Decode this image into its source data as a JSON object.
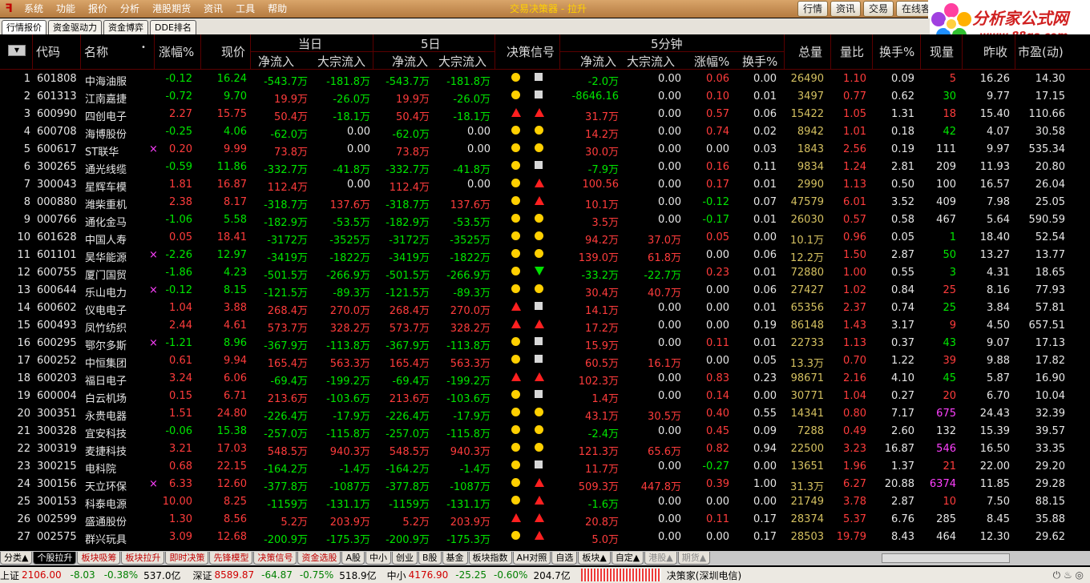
{
  "menu": {
    "items": [
      "系统",
      "功能",
      "报价",
      "分析",
      "港股期货",
      "资讯",
      "工具",
      "帮助"
    ],
    "title": "交易决策器 - 拉升",
    "tabs": [
      "行情",
      "资讯",
      "交易",
      "在线客"
    ]
  },
  "brand": {
    "name": "分析家公式网",
    "url": "www.88gs.com"
  },
  "subtabs": [
    "行情报价",
    "资金驱动力",
    "资金博弈",
    "DDE排名"
  ],
  "headers": {
    "code": "代码",
    "name": "名称",
    "change_pct": "涨幅%",
    "price": "现价",
    "day": "当日",
    "day5": "5日",
    "net_in": "净流入",
    "block_in": "大宗流入",
    "signal": "决策信号",
    "min5": "5分钟",
    "chg": "涨幅%",
    "turnover": "换手%",
    "vol": "总量",
    "vol_ratio": "量比",
    "turn": "换手%",
    "cur_vol": "现量",
    "prev_close": "昨收",
    "pe": "市盈(动)"
  },
  "rows": [
    {
      "n": "1",
      "code": "601808",
      "name": "中海油服",
      "m": "",
      "chg": "-0.12",
      "price": "16.24",
      "dn": "-543.7万",
      "db": "-181.8万",
      "fn": "-543.7万",
      "fb": "-181.8万",
      "s1": "c",
      "s2": "q",
      "mn": "-2.0万",
      "mb": "0.00",
      "mc": "0.06",
      "mt": "0.00",
      "vol": "26490",
      "vr": "1.10",
      "to": "0.09",
      "cv": "5",
      "pc": "16.26",
      "pe": "14.30"
    },
    {
      "n": "2",
      "code": "601313",
      "name": "江南嘉捷",
      "m": "",
      "chg": "-0.72",
      "price": "9.70",
      "dn": "19.9万",
      "db": "-26.0万",
      "fn": "19.9万",
      "fb": "-26.0万",
      "s1": "c",
      "s2": "q",
      "mn": "-8646.16",
      "mb": "0.00",
      "mc": "0.10",
      "mt": "0.01",
      "vol": "3497",
      "vr": "0.77",
      "to": "0.62",
      "cv": "30",
      "pc": "9.77",
      "pe": "17.15"
    },
    {
      "n": "3",
      "code": "600990",
      "name": "四创电子",
      "m": "",
      "chg": "2.27",
      "price": "15.75",
      "dn": "50.4万",
      "db": "-18.1万",
      "fn": "50.4万",
      "fb": "-18.1万",
      "s1": "u",
      "s2": "u",
      "mn": "31.7万",
      "mb": "0.00",
      "mc": "0.57",
      "mt": "0.06",
      "vol": "15422",
      "vr": "1.05",
      "to": "1.31",
      "cv": "18",
      "pc": "15.40",
      "pe": "110.66"
    },
    {
      "n": "4",
      "code": "600708",
      "name": "海博股份",
      "m": "",
      "chg": "-0.25",
      "price": "4.06",
      "dn": "-62.0万",
      "db": "0.00",
      "fn": "-62.0万",
      "fb": "0.00",
      "s1": "c",
      "s2": "c",
      "mn": "14.2万",
      "mb": "0.00",
      "mc": "0.74",
      "mt": "0.02",
      "vol": "8942",
      "vr": "1.01",
      "to": "0.18",
      "cv": "42",
      "pc": "4.07",
      "pe": "30.58"
    },
    {
      "n": "5",
      "code": "600617",
      "name": "ST联华",
      "m": "×",
      "chg": "0.20",
      "price": "9.99",
      "dn": "73.8万",
      "db": "0.00",
      "fn": "73.8万",
      "fb": "0.00",
      "s1": "c",
      "s2": "c",
      "mn": "30.0万",
      "mb": "0.00",
      "mc": "0.00",
      "mt": "0.03",
      "vol": "1843",
      "vr": "2.56",
      "to": "0.19",
      "cv": "111",
      "pc": "9.97",
      "pe": "535.34"
    },
    {
      "n": "6",
      "code": "300265",
      "name": "通光线缆",
      "m": "",
      "chg": "-0.59",
      "price": "11.86",
      "dn": "-332.7万",
      "db": "-41.8万",
      "fn": "-332.7万",
      "fb": "-41.8万",
      "s1": "c",
      "s2": "q",
      "mn": "-7.9万",
      "mb": "0.00",
      "mc": "0.16",
      "mt": "0.11",
      "vol": "9834",
      "vr": "1.24",
      "to": "2.81",
      "cv": "209",
      "pc": "11.93",
      "pe": "20.80"
    },
    {
      "n": "7",
      "code": "300043",
      "name": "星辉车模",
      "m": "",
      "chg": "1.81",
      "price": "16.87",
      "dn": "112.4万",
      "db": "0.00",
      "fn": "112.4万",
      "fb": "0.00",
      "s1": "c",
      "s2": "u",
      "mn": "100.56",
      "mb": "0.00",
      "mc": "0.17",
      "mt": "0.01",
      "vol": "2990",
      "vr": "1.13",
      "to": "0.50",
      "cv": "100",
      "pc": "16.57",
      "pe": "26.04"
    },
    {
      "n": "8",
      "code": "000880",
      "name": "潍柴重机",
      "m": "",
      "chg": "2.38",
      "price": "8.17",
      "dn": "-318.7万",
      "db": "137.6万",
      "fn": "-318.7万",
      "fb": "137.6万",
      "s1": "c",
      "s2": "u",
      "mn": "10.1万",
      "mb": "0.00",
      "mc": "-0.12",
      "mt": "0.07",
      "vol": "47579",
      "vr": "6.01",
      "to": "3.52",
      "cv": "409",
      "pc": "7.98",
      "pe": "25.05"
    },
    {
      "n": "9",
      "code": "000766",
      "name": "通化金马",
      "m": "",
      "chg": "-1.06",
      "price": "5.58",
      "dn": "-182.9万",
      "db": "-53.5万",
      "fn": "-182.9万",
      "fb": "-53.5万",
      "s1": "c",
      "s2": "c",
      "mn": "3.5万",
      "mb": "0.00",
      "mc": "-0.17",
      "mt": "0.01",
      "vol": "26030",
      "vr": "0.57",
      "to": "0.58",
      "cv": "467",
      "pc": "5.64",
      "pe": "590.59"
    },
    {
      "n": "10",
      "code": "601628",
      "name": "中国人寿",
      "m": "",
      "chg": "0.05",
      "price": "18.41",
      "dn": "-3172万",
      "db": "-3525万",
      "fn": "-3172万",
      "fb": "-3525万",
      "s1": "c",
      "s2": "c",
      "mn": "94.2万",
      "mb": "37.0万",
      "mc": "0.05",
      "mt": "0.00",
      "vol": "10.1万",
      "vr": "0.96",
      "to": "0.05",
      "cv": "1",
      "pc": "18.40",
      "pe": "52.54"
    },
    {
      "n": "11",
      "code": "601101",
      "name": "昊华能源",
      "m": "×",
      "chg": "-2.26",
      "price": "12.97",
      "dn": "-3419万",
      "db": "-1822万",
      "fn": "-3419万",
      "fb": "-1822万",
      "s1": "c",
      "s2": "c",
      "mn": "139.0万",
      "mb": "61.8万",
      "mc": "0.00",
      "mt": "0.06",
      "vol": "12.2万",
      "vr": "1.50",
      "to": "2.87",
      "cv": "50",
      "pc": "13.27",
      "pe": "13.77"
    },
    {
      "n": "12",
      "code": "600755",
      "name": "厦门国贸",
      "m": "",
      "chg": "-1.86",
      "price": "4.23",
      "dn": "-501.5万",
      "db": "-266.9万",
      "fn": "-501.5万",
      "fb": "-266.9万",
      "s1": "c",
      "s2": "d",
      "mn": "-33.2万",
      "mb": "-22.7万",
      "mc": "0.23",
      "mt": "0.01",
      "vol": "72880",
      "vr": "1.00",
      "to": "0.55",
      "cv": "3",
      "pc": "4.31",
      "pe": "18.65"
    },
    {
      "n": "13",
      "code": "600644",
      "name": "乐山电力",
      "m": "×",
      "chg": "-0.12",
      "price": "8.15",
      "dn": "-121.5万",
      "db": "-89.3万",
      "fn": "-121.5万",
      "fb": "-89.3万",
      "s1": "c",
      "s2": "c",
      "mn": "30.4万",
      "mb": "40.7万",
      "mc": "0.00",
      "mt": "0.06",
      "vol": "27427",
      "vr": "1.02",
      "to": "0.84",
      "cv": "25",
      "pc": "8.16",
      "pe": "77.93"
    },
    {
      "n": "14",
      "code": "600602",
      "name": "仪电电子",
      "m": "",
      "chg": "1.04",
      "price": "3.88",
      "dn": "268.4万",
      "db": "270.0万",
      "fn": "268.4万",
      "fb": "270.0万",
      "s1": "u",
      "s2": "q",
      "mn": "14.1万",
      "mb": "0.00",
      "mc": "0.00",
      "mt": "0.01",
      "vol": "65356",
      "vr": "2.37",
      "to": "0.74",
      "cv": "25",
      "pc": "3.84",
      "pe": "57.81"
    },
    {
      "n": "15",
      "code": "600493",
      "name": "凤竹纺织",
      "m": "",
      "chg": "2.44",
      "price": "4.61",
      "dn": "573.7万",
      "db": "328.2万",
      "fn": "573.7万",
      "fb": "328.2万",
      "s1": "u",
      "s2": "u",
      "mn": "17.2万",
      "mb": "0.00",
      "mc": "0.00",
      "mt": "0.19",
      "vol": "86148",
      "vr": "1.43",
      "to": "3.17",
      "cv": "9",
      "pc": "4.50",
      "pe": "657.51"
    },
    {
      "n": "16",
      "code": "600295",
      "name": "鄂尔多斯",
      "m": "×",
      "chg": "-1.21",
      "price": "8.96",
      "dn": "-367.9万",
      "db": "-113.8万",
      "fn": "-367.9万",
      "fb": "-113.8万",
      "s1": "c",
      "s2": "q",
      "mn": "15.9万",
      "mb": "0.00",
      "mc": "0.11",
      "mt": "0.01",
      "vol": "22733",
      "vr": "1.13",
      "to": "0.37",
      "cv": "43",
      "pc": "9.07",
      "pe": "17.13"
    },
    {
      "n": "17",
      "code": "600252",
      "name": "中恒集团",
      "m": "",
      "chg": "0.61",
      "price": "9.94",
      "dn": "165.4万",
      "db": "563.3万",
      "fn": "165.4万",
      "fb": "563.3万",
      "s1": "c",
      "s2": "q",
      "mn": "60.5万",
      "mb": "16.1万",
      "mc": "0.00",
      "mt": "0.05",
      "vol": "13.3万",
      "vr": "0.70",
      "to": "1.22",
      "cv": "39",
      "pc": "9.88",
      "pe": "17.82"
    },
    {
      "n": "18",
      "code": "600203",
      "name": "福日电子",
      "m": "",
      "chg": "3.24",
      "price": "6.06",
      "dn": "-69.4万",
      "db": "-199.2万",
      "fn": "-69.4万",
      "fb": "-199.2万",
      "s1": "u",
      "s2": "u",
      "mn": "102.3万",
      "mb": "0.00",
      "mc": "0.83",
      "mt": "0.23",
      "vol": "98671",
      "vr": "2.16",
      "to": "4.10",
      "cv": "45",
      "pc": "5.87",
      "pe": "16.90"
    },
    {
      "n": "19",
      "code": "600004",
      "name": "白云机场",
      "m": "",
      "chg": "0.15",
      "price": "6.71",
      "dn": "213.6万",
      "db": "-103.6万",
      "fn": "213.6万",
      "fb": "-103.6万",
      "s1": "c",
      "s2": "q",
      "mn": "1.4万",
      "mb": "0.00",
      "mc": "0.14",
      "mt": "0.00",
      "vol": "30771",
      "vr": "1.04",
      "to": "0.27",
      "cv": "20",
      "pc": "6.70",
      "pe": "10.04"
    },
    {
      "n": "20",
      "code": "300351",
      "name": "永贵电器",
      "m": "",
      "chg": "1.51",
      "price": "24.80",
      "dn": "-226.4万",
      "db": "-17.9万",
      "fn": "-226.4万",
      "fb": "-17.9万",
      "s1": "c",
      "s2": "c",
      "mn": "43.1万",
      "mb": "30.5万",
      "mc": "0.40",
      "mt": "0.55",
      "vol": "14341",
      "vr": "0.80",
      "to": "7.17",
      "cv": "675",
      "pc": "24.43",
      "pe": "32.39"
    },
    {
      "n": "21",
      "code": "300328",
      "name": "宜安科技",
      "m": "",
      "chg": "-0.06",
      "price": "15.38",
      "dn": "-257.0万",
      "db": "-115.8万",
      "fn": "-257.0万",
      "fb": "-115.8万",
      "s1": "c",
      "s2": "c",
      "mn": "-2.4万",
      "mb": "0.00",
      "mc": "0.45",
      "mt": "0.09",
      "vol": "7288",
      "vr": "0.49",
      "to": "2.60",
      "cv": "132",
      "pc": "15.39",
      "pe": "39.57"
    },
    {
      "n": "22",
      "code": "300319",
      "name": "麦捷科技",
      "m": "",
      "chg": "3.21",
      "price": "17.03",
      "dn": "548.5万",
      "db": "940.3万",
      "fn": "548.5万",
      "fb": "940.3万",
      "s1": "c",
      "s2": "c",
      "mn": "121.3万",
      "mb": "65.6万",
      "mc": "0.82",
      "mt": "0.94",
      "vol": "22500",
      "vr": "3.23",
      "to": "16.87",
      "cv": "546",
      "pc": "16.50",
      "pe": "33.35"
    },
    {
      "n": "23",
      "code": "300215",
      "name": "电科院",
      "m": "",
      "chg": "0.68",
      "price": "22.15",
      "dn": "-164.2万",
      "db": "-1.4万",
      "fn": "-164.2万",
      "fb": "-1.4万",
      "s1": "c",
      "s2": "q",
      "mn": "11.7万",
      "mb": "0.00",
      "mc": "-0.27",
      "mt": "0.00",
      "vol": "13651",
      "vr": "1.96",
      "to": "1.37",
      "cv": "21",
      "pc": "22.00",
      "pe": "29.20"
    },
    {
      "n": "24",
      "code": "300156",
      "name": "天立环保",
      "m": "×",
      "chg": "6.33",
      "price": "12.60",
      "dn": "-377.8万",
      "db": "-1087万",
      "fn": "-377.8万",
      "fb": "-1087万",
      "s1": "c",
      "s2": "u",
      "mn": "509.3万",
      "mb": "447.8万",
      "mc": "0.39",
      "mt": "1.00",
      "vol": "31.3万",
      "vr": "6.27",
      "to": "20.88",
      "cv": "6374",
      "pc": "11.85",
      "pe": "29.28"
    },
    {
      "n": "25",
      "code": "300153",
      "name": "科泰电源",
      "m": "",
      "chg": "10.00",
      "price": "8.25",
      "dn": "-1159万",
      "db": "-131.1万",
      "fn": "-1159万",
      "fb": "-131.1万",
      "s1": "c",
      "s2": "u",
      "mn": "-1.6万",
      "mb": "0.00",
      "mc": "0.00",
      "mt": "0.00",
      "vol": "21749",
      "vr": "3.78",
      "to": "2.87",
      "cv": "10",
      "pc": "7.50",
      "pe": "88.15"
    },
    {
      "n": "26",
      "code": "002599",
      "name": "盛通股份",
      "m": "",
      "chg": "1.30",
      "price": "8.56",
      "dn": "5.2万",
      "db": "203.9万",
      "fn": "5.2万",
      "fb": "203.9万",
      "s1": "u",
      "s2": "u",
      "mn": "20.8万",
      "mb": "0.00",
      "mc": "0.11",
      "mt": "0.17",
      "vol": "28374",
      "vr": "5.37",
      "to": "6.76",
      "cv": "285",
      "pc": "8.45",
      "pe": "35.88"
    },
    {
      "n": "27",
      "code": "002575",
      "name": "群兴玩具",
      "m": "",
      "chg": "3.09",
      "price": "12.68",
      "dn": "-200.9万",
      "db": "-175.3万",
      "fn": "-200.9万",
      "fb": "-175.3万",
      "s1": "c",
      "s2": "u",
      "mn": "5.0万",
      "mb": "0.00",
      "mc": "0.00",
      "mt": "0.17",
      "vol": "28503",
      "vr": "19.79",
      "to": "8.43",
      "cv": "464",
      "pc": "12.30",
      "pe": "29.62"
    }
  ],
  "bottom_tabs": [
    {
      "label": "分类▲",
      "style": "normal"
    },
    {
      "label": "个股拉升",
      "style": "active"
    },
    {
      "label": "板块吸筹",
      "style": "red"
    },
    {
      "label": "板块拉升",
      "style": "red"
    },
    {
      "label": "即时决策",
      "style": "red"
    },
    {
      "label": "先锋模型",
      "style": "red"
    },
    {
      "label": "决策信号",
      "style": "red"
    },
    {
      "label": "资金选股",
      "style": "red"
    },
    {
      "label": "A股",
      "style": "normal"
    },
    {
      "label": "中小",
      "style": "normal"
    },
    {
      "label": "创业",
      "style": "normal"
    },
    {
      "label": "B股",
      "style": "normal"
    },
    {
      "label": "基金",
      "style": "normal"
    },
    {
      "label": "板块指数",
      "style": "normal"
    },
    {
      "label": "AH对照",
      "style": "normal"
    },
    {
      "label": "自选",
      "style": "normal"
    },
    {
      "label": "板块▲",
      "style": "normal"
    },
    {
      "label": "自定▲",
      "style": "normal"
    },
    {
      "label": "港股▲",
      "style": "gray"
    },
    {
      "label": "期货▲",
      "style": "gray"
    }
  ],
  "status": {
    "sh_label": "上证",
    "sh_val": "2106.00",
    "sh_chg": "-8.03",
    "sh_pct": "-0.38%",
    "sh_amt": "537.0亿",
    "sz_label": "深证",
    "sz_val": "8589.87",
    "sz_chg": "-64.87",
    "sz_pct": "-0.75%",
    "sz_amt": "518.9亿",
    "zx_label": "中小",
    "zx_val": "4176.90",
    "zx_chg": "-25.25",
    "zx_pct": "-0.60%",
    "zx_amt": "204.7亿",
    "server": "决策家(深圳电信)"
  }
}
